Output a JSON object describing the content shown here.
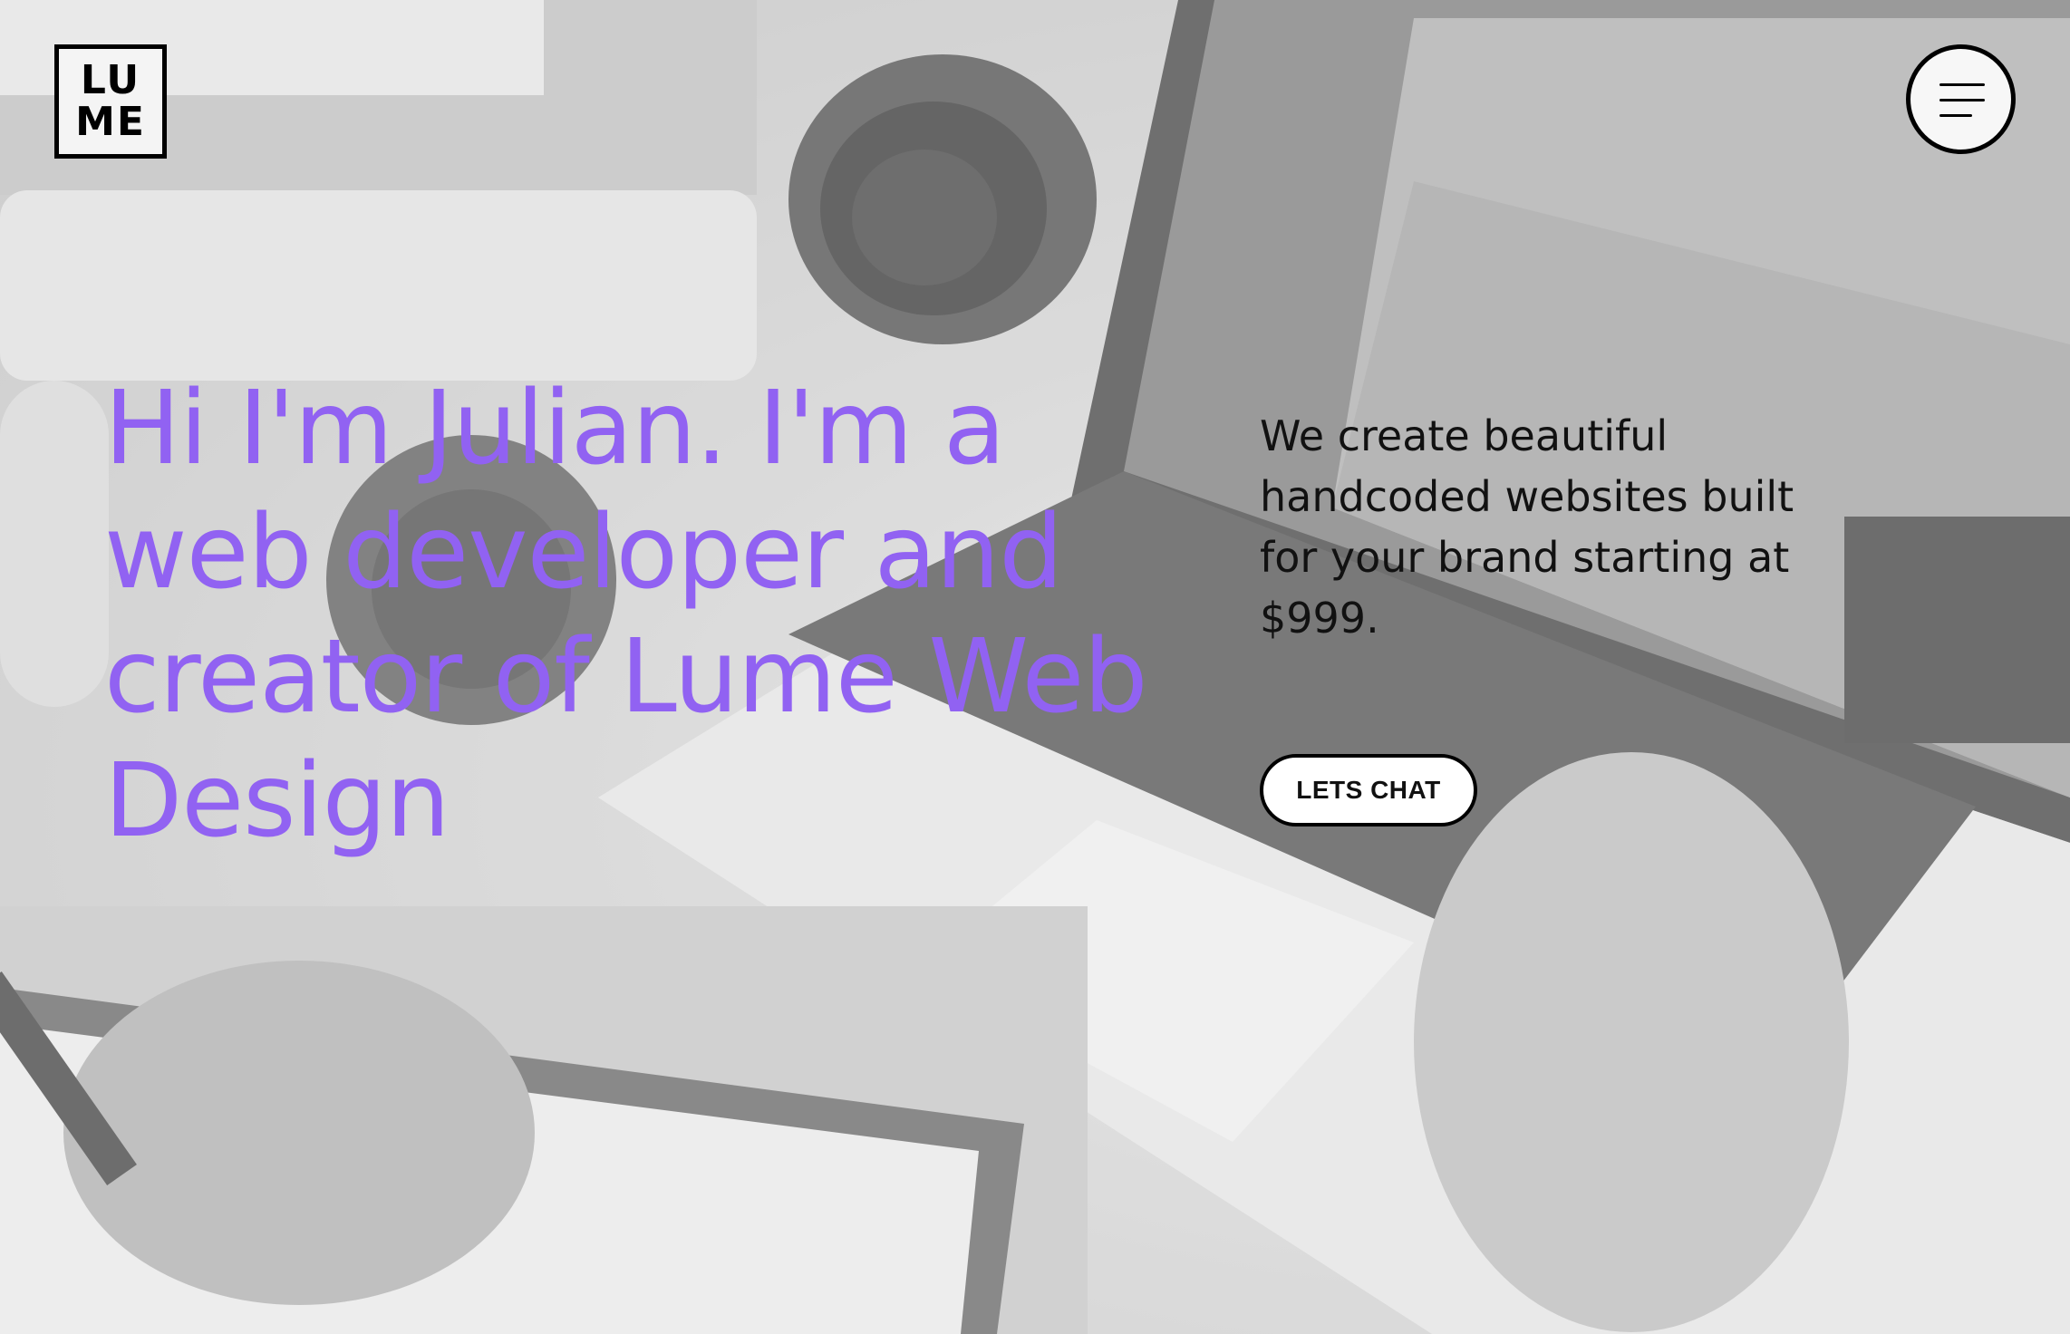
{
  "logo": {
    "line1": "LU",
    "line2": "ME"
  },
  "menu": {
    "icon": "hamburger-menu-icon"
  },
  "hero": {
    "headline": "Hi I'm Julian. I'm a web developer and creator of Lume Web Design",
    "intro": "We create beautiful handcoded websites built for your brand starting at $999.",
    "cta_label": "LETS CHAT"
  },
  "colors": {
    "accent": "#9162f2",
    "text": "#111111"
  }
}
